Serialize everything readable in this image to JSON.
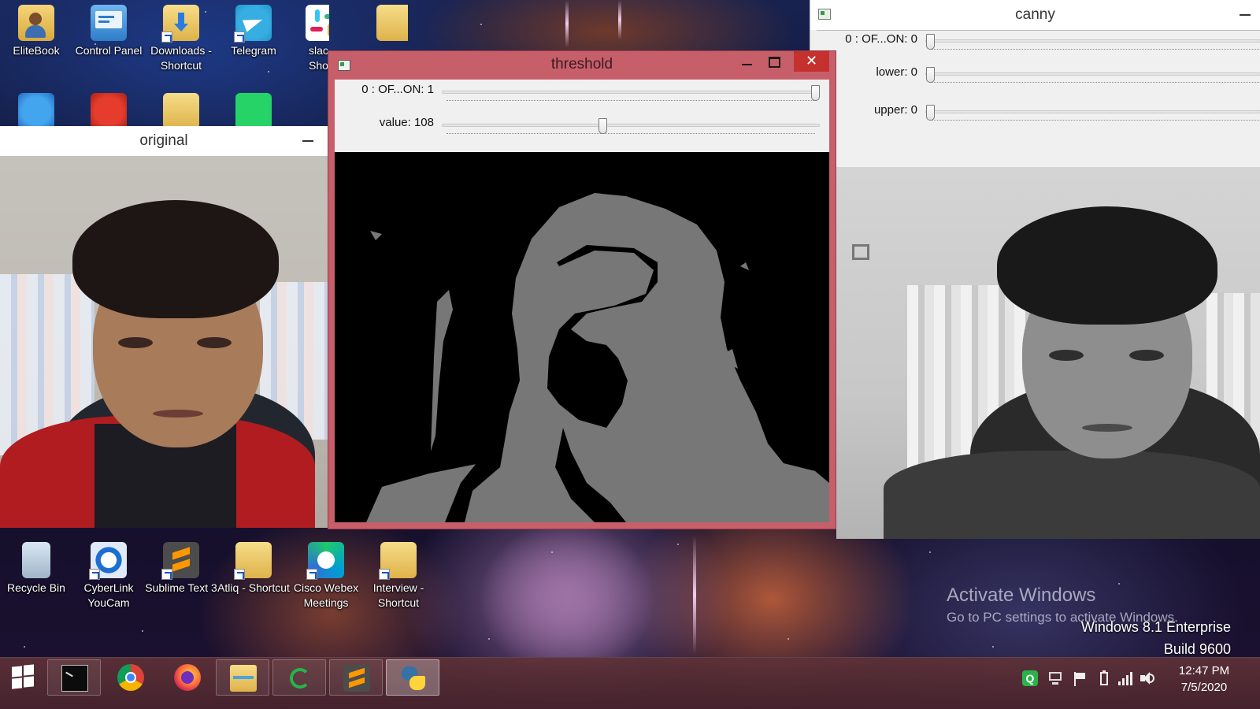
{
  "desktop": {
    "top_icons": [
      {
        "label": "EliteBook",
        "icon": "user-folder-icon"
      },
      {
        "label": "Control Panel",
        "icon": "control-panel-icon"
      },
      {
        "label": "Downloads - Shortcut",
        "icon": "downloads-folder-icon"
      },
      {
        "label": "Telegram",
        "icon": "telegram-icon"
      },
      {
        "label": "slac Shor",
        "icon": "slack-icon"
      }
    ],
    "bottom_icons": [
      {
        "label": "Recycle Bin",
        "icon": "recycle-bin-icon"
      },
      {
        "label": "CyberLink YouCam",
        "icon": "youcam-icon"
      },
      {
        "label": "Sublime Text 3",
        "icon": "sublime-text-icon"
      },
      {
        "label": "Atliq - Shortcut",
        "icon": "folder-icon"
      },
      {
        "label": "Cisco Webex Meetings",
        "icon": "webex-icon"
      },
      {
        "label": "Interview - Shortcut",
        "icon": "folder-icon"
      }
    ]
  },
  "windows": {
    "threshold": {
      "title": "threshold",
      "close_glyph": "✕",
      "trackbars": [
        {
          "label": "0 : OF...ON: 1",
          "value": 1,
          "max": 1
        },
        {
          "label": "value: 108",
          "value": 108,
          "max": 255
        }
      ]
    },
    "canny": {
      "title": "canny",
      "trackbars": [
        {
          "label": "0 : OF...ON: 0",
          "value": 0
        },
        {
          "label": "lower: 0",
          "value": 0
        },
        {
          "label": "upper: 0",
          "value": 0
        }
      ]
    },
    "original": {
      "title": "original"
    }
  },
  "watermark": {
    "line1": "Activate Windows",
    "line2": "Go to PC settings to activate Windows.",
    "edition": "Windows 8.1 Enterprise",
    "build": "Build 9600"
  },
  "taskbar": {
    "apps": [
      "command-prompt-icon",
      "chrome-icon",
      "firefox-icon",
      "file-explorer-icon",
      "refresh-app-icon",
      "sublime-text-icon",
      "python-icon"
    ],
    "active_app": "python-icon",
    "tray": [
      "qt-icon",
      "network-monitor-icon",
      "flag-icon",
      "battery-icon",
      "signal-icon",
      "volume-icon"
    ],
    "clock_time": "12:47 PM",
    "clock_date": "7/5/2020"
  }
}
